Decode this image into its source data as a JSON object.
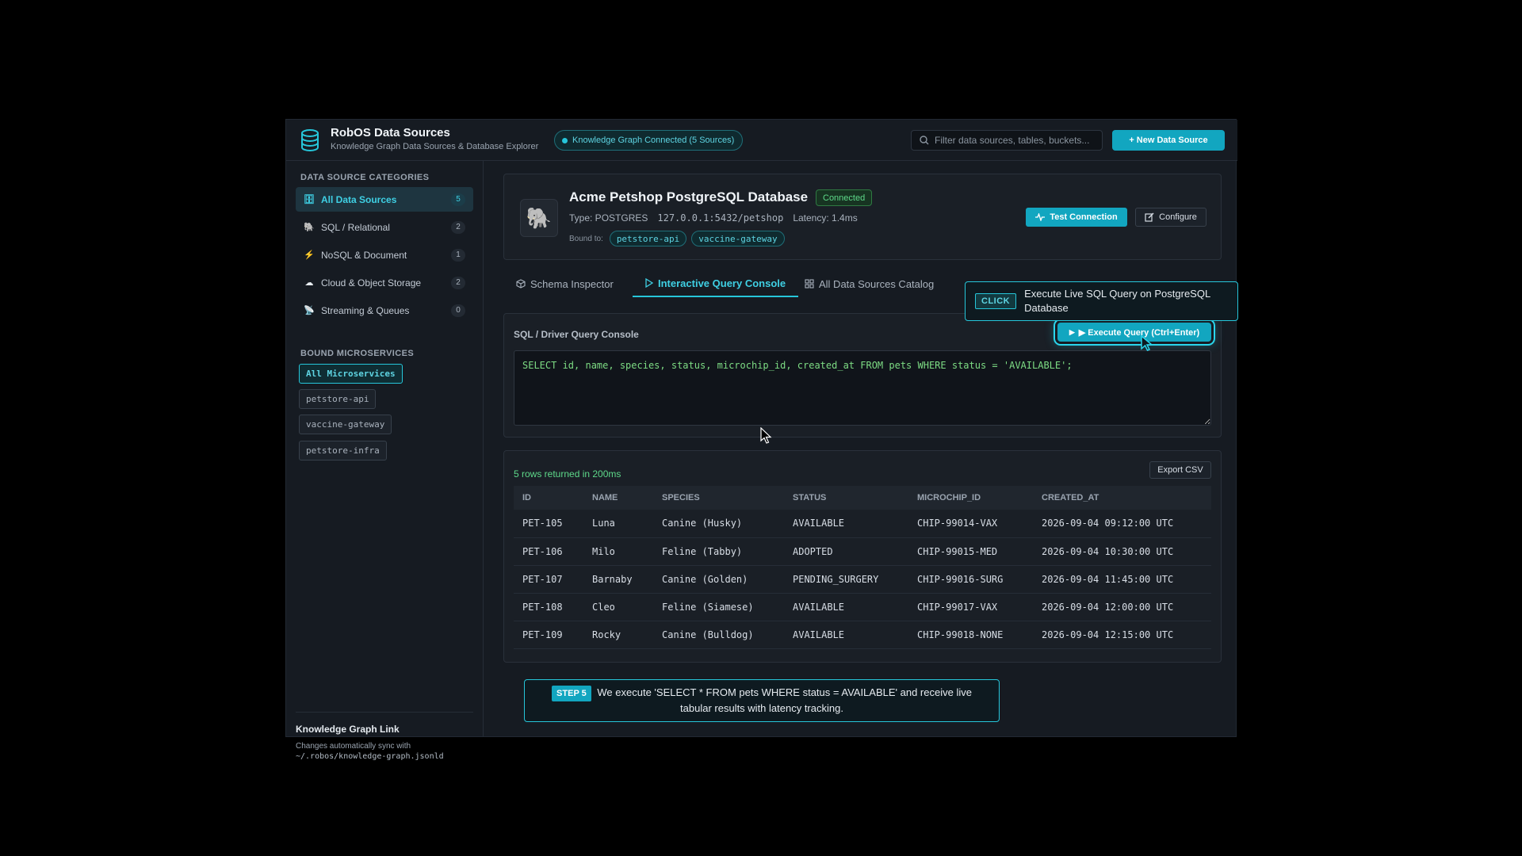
{
  "header": {
    "title": "RobOS Data Sources",
    "subtitle": "Knowledge Graph Data Sources & Database Explorer",
    "kg_status": "Knowledge Graph Connected (5 Sources)",
    "search_placeholder": "Filter data sources, tables, buckets...",
    "new_button": "+ New Data Source"
  },
  "sidebar": {
    "categories_title": "DATA SOURCE CATEGORIES",
    "categories": [
      {
        "label": "All Data Sources",
        "count": "5",
        "icon": "database-icon"
      },
      {
        "label": "SQL / Relational",
        "count": "2",
        "icon": "elephant-icon"
      },
      {
        "label": "NoSQL & Document",
        "count": "1",
        "icon": "lightning-icon"
      },
      {
        "label": "Cloud & Object Storage",
        "count": "2",
        "icon": "cloud-icon"
      },
      {
        "label": "Streaming & Queues",
        "count": "0",
        "icon": "satellite-icon"
      }
    ],
    "microservices_title": "BOUND MICROSERVICES",
    "microservices": [
      "All Microservices",
      "petstore-api",
      "vaccine-gateway",
      "petstore-infra"
    ],
    "kg_link_title": "Knowledge Graph Link",
    "kg_link_text": "Changes automatically sync with",
    "kg_link_path": "~/.robos/knowledge-graph.jsonld"
  },
  "source": {
    "name": "Acme Petshop PostgreSQL Database",
    "status": "Connected",
    "type": "Type: POSTGRES",
    "endpoint": "127.0.0.1:5432/petshop",
    "latency": "Latency: 1.4ms",
    "bound_label": "Bound to:",
    "bound_tags": [
      "petstore-api",
      "vaccine-gateway"
    ],
    "test_button": "Test Connection",
    "configure_button": "Configure"
  },
  "tabs": [
    "Schema Inspector",
    "Interactive Query Console",
    "All Data Sources Catalog"
  ],
  "active_tab": "Interactive Query Console",
  "console": {
    "title": "SQL / Driver Query Console",
    "execute_button": "▶ Execute Query (Ctrl+Enter)",
    "query": "SELECT id, name, species, status, microchip_id, created_at FROM pets WHERE status = 'AVAILABLE';"
  },
  "results": {
    "status": "5 rows returned in 200ms",
    "export_button": "Export CSV",
    "columns": [
      "ID",
      "NAME",
      "SPECIES",
      "STATUS",
      "MICROCHIP_ID",
      "CREATED_AT"
    ],
    "rows": [
      [
        "PET-105",
        "Luna",
        "Canine (Husky)",
        "AVAILABLE",
        "CHIP-99014-VAX",
        "2026-09-04 09:12:00 UTC"
      ],
      [
        "PET-106",
        "Milo",
        "Feline (Tabby)",
        "ADOPTED",
        "CHIP-99015-MED",
        "2026-09-04 10:30:00 UTC"
      ],
      [
        "PET-107",
        "Barnaby",
        "Canine (Golden)",
        "PENDING_SURGERY",
        "CHIP-99016-SURG",
        "2026-09-04 11:45:00 UTC"
      ],
      [
        "PET-108",
        "Cleo",
        "Feline (Siamese)",
        "AVAILABLE",
        "CHIP-99017-VAX",
        "2026-09-04 12:00:00 UTC"
      ],
      [
        "PET-109",
        "Rocky",
        "Canine (Bulldog)",
        "AVAILABLE",
        "CHIP-99018-NONE",
        "2026-09-04 12:15:00 UTC"
      ]
    ]
  },
  "click_tooltip": {
    "badge": "CLICK",
    "text": "Execute Live SQL Query on PostgreSQL Database"
  },
  "step_banner": {
    "badge": "STEP 5",
    "text": "We execute 'SELECT * FROM pets WHERE status = AVAILABLE' and receive live tabular results with latency tracking."
  },
  "colors": {
    "accent": "#26c6da",
    "accent_button": "#12a6c0",
    "success": "#5ed98a",
    "background": "#161b22",
    "sql_text": "#7ddc84"
  }
}
